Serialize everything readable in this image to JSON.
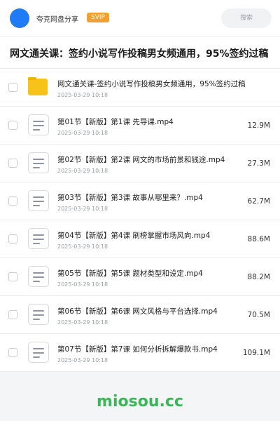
{
  "header": {
    "username": "夸克网盘分享",
    "badge": "SVIP",
    "search_placeholder": "搜索",
    "avatar_color": "#1f7cf6",
    "badge_color": "#f2a12e"
  },
  "page_title": "网文通关课：签约小说写作投稿男女频通用，95%签约过稿",
  "files": [
    {
      "type": "folder",
      "name": "网文通关课-签约小说写作投稿男女频通用，95%签约过稿",
      "date": "2025-03-29 10:18",
      "size": ""
    },
    {
      "type": "video",
      "name": "第01节【新版】第1课 先导课.mp4",
      "date": "2025-03-29 10:18",
      "size": "12.9M"
    },
    {
      "type": "video",
      "name": "第02节【新版】第2课 网文的市场前景和钱途.mp4",
      "date": "2025-03-29 10:18",
      "size": "27.3M"
    },
    {
      "type": "video",
      "name": "第03节【新版】第3课 故事从哪里来？.mp4",
      "date": "2025-03-29 10:18",
      "size": "62.7M"
    },
    {
      "type": "video",
      "name": "第04节【新版】第4课 刷榜掌握市场风向.mp4",
      "date": "2025-03-29 10:18",
      "size": "88.6M"
    },
    {
      "type": "video",
      "name": "第05节【新版】第5课 题材类型和设定.mp4",
      "date": "2025-03-29 10:18",
      "size": "88.2M"
    },
    {
      "type": "video",
      "name": "第06节【新版】第6课 网文风格与平台选择.mp4",
      "date": "2025-03-29 10:18",
      "size": "70.5M"
    },
    {
      "type": "video",
      "name": "第07节【新版】第7课 如何分析拆解爆款书.mp4",
      "date": "2025-03-29 10:18",
      "size": "109.1M"
    }
  ],
  "watermark": "miosou.cc"
}
